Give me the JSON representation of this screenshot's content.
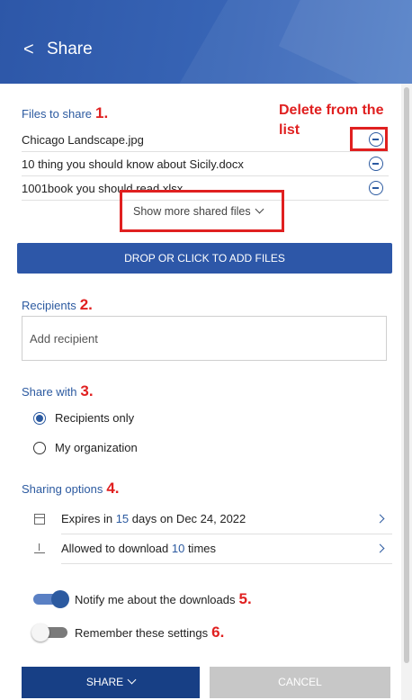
{
  "header": {
    "back_icon": "chevron-left-icon",
    "back_glyph": "<",
    "title": "Share"
  },
  "files": {
    "section_label": "Files to share",
    "marker": "1.",
    "delete_note_line1": "Delete from the",
    "delete_note_line2": "list",
    "items": [
      {
        "name": "Chicago Landscape.jpg"
      },
      {
        "name": "10 thing you should know about Sicily.docx"
      },
      {
        "name": "1001book you should read.xlsx"
      }
    ],
    "show_more_label": "Show more shared files",
    "add_files_label": "DROP OR CLICK TO ADD FILES"
  },
  "recipients": {
    "section_label": "Recipients",
    "marker": "2.",
    "placeholder": "Add recipient"
  },
  "share_with": {
    "section_label": "Share with",
    "marker": "3.",
    "options": [
      {
        "label": "Recipients only",
        "selected": true
      },
      {
        "label": "My organization",
        "selected": false
      }
    ]
  },
  "sharing_options": {
    "section_label": "Sharing options",
    "marker": "4.",
    "expires": {
      "prefix": "Expires in ",
      "days": "15",
      "suffix": " days on Dec 24, 2022"
    },
    "download": {
      "prefix": "Allowed to download ",
      "count": "10",
      "suffix": " times"
    }
  },
  "toggles": [
    {
      "label": "Notify me about the downloads",
      "marker": "5.",
      "on": true
    },
    {
      "label": "Remember these settings",
      "marker": "6.",
      "on": false
    }
  ],
  "footer": {
    "share_label": "SHARE",
    "cancel_label": "CANCEL"
  },
  "colors": {
    "accent": "#2c5aa0",
    "header": "#2d57a8",
    "annotation_red": "#e02020",
    "share_button": "#173f85",
    "cancel_button": "#c7c7c7"
  }
}
